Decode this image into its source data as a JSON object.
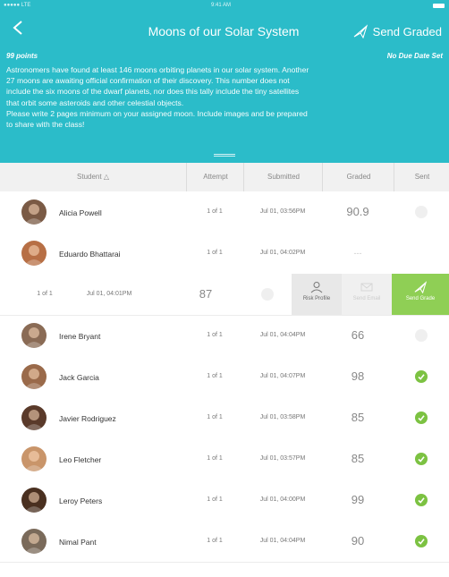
{
  "status_bar": {
    "carrier": "●●●●● LTE",
    "time": "9:41 AM"
  },
  "header": {
    "title": "Moons of our Solar System",
    "send_graded_label": "Send Graded",
    "points": "99 points",
    "due": "No Due Date Set",
    "description": "Astronomers have found at least 146 moons orbiting planets in our solar system. Another\n27 moons are awaiting official confirmation of their discovery. This number does not\ninclude the six moons of the dwarf planets, nor does this tally include the tiny satellites\nthat orbit some asteroids and other celestial objects.\nPlease write 2 pages minimum on your assigned moon. Include images and be prepared\nto share with the class!",
    "accent_color": "#2bbcc9"
  },
  "columns": {
    "student": "Student △",
    "attempt": "Attempt",
    "submitted": "Submitted",
    "graded": "Graded",
    "sent": "Sent"
  },
  "rows": [
    {
      "name": "Alicia Powell",
      "attempt": "1 of 1",
      "submitted": "Jul 01, 03:56PM",
      "graded": "90.9",
      "sent": false,
      "avatar_color": "#7a5a45"
    },
    {
      "name": "Eduardo Bhattarai",
      "attempt": "1 of 1",
      "submitted": "Jul 01, 04:02PM",
      "graded": "---",
      "sent": false,
      "avatar_color": "#b76f45"
    },
    {
      "name": "Irene Bryant",
      "attempt": "1 of 1",
      "submitted": "Jul 01, 04:04PM",
      "graded": "66",
      "sent": false,
      "avatar_color": "#8a6b55"
    },
    {
      "name": "Jack Garcia",
      "attempt": "1 of 1",
      "submitted": "Jul 01, 04:07PM",
      "graded": "98",
      "sent": true,
      "avatar_color": "#9a6a4a"
    },
    {
      "name": "Javier Rodriguez",
      "attempt": "1 of 1",
      "submitted": "Jul 01, 03:58PM",
      "graded": "85",
      "sent": true,
      "avatar_color": "#5a3a2a"
    },
    {
      "name": "Leo Fletcher",
      "attempt": "1 of 1",
      "submitted": "Jul 01, 03:57PM",
      "graded": "85",
      "sent": true,
      "avatar_color": "#c9956a"
    },
    {
      "name": "Leroy Peters",
      "attempt": "1 of 1",
      "submitted": "Jul 01, 04:00PM",
      "graded": "99",
      "sent": true,
      "avatar_color": "#4a3020"
    },
    {
      "name": "Nimal Pant",
      "attempt": "1 of 1",
      "submitted": "Jul 01, 04:04PM",
      "graded": "90",
      "sent": true,
      "avatar_color": "#7a6a5a"
    }
  ],
  "swipe_row": {
    "attempt": "1 of 1",
    "submitted": "Jul 01, 04:01PM",
    "graded": "87",
    "risk_profile": "Risk Profile",
    "send_email": "Send Email",
    "send_grade": "Send Grade",
    "send_grade_color": "#8fcf55"
  },
  "sent_on_color": "#7cc242"
}
